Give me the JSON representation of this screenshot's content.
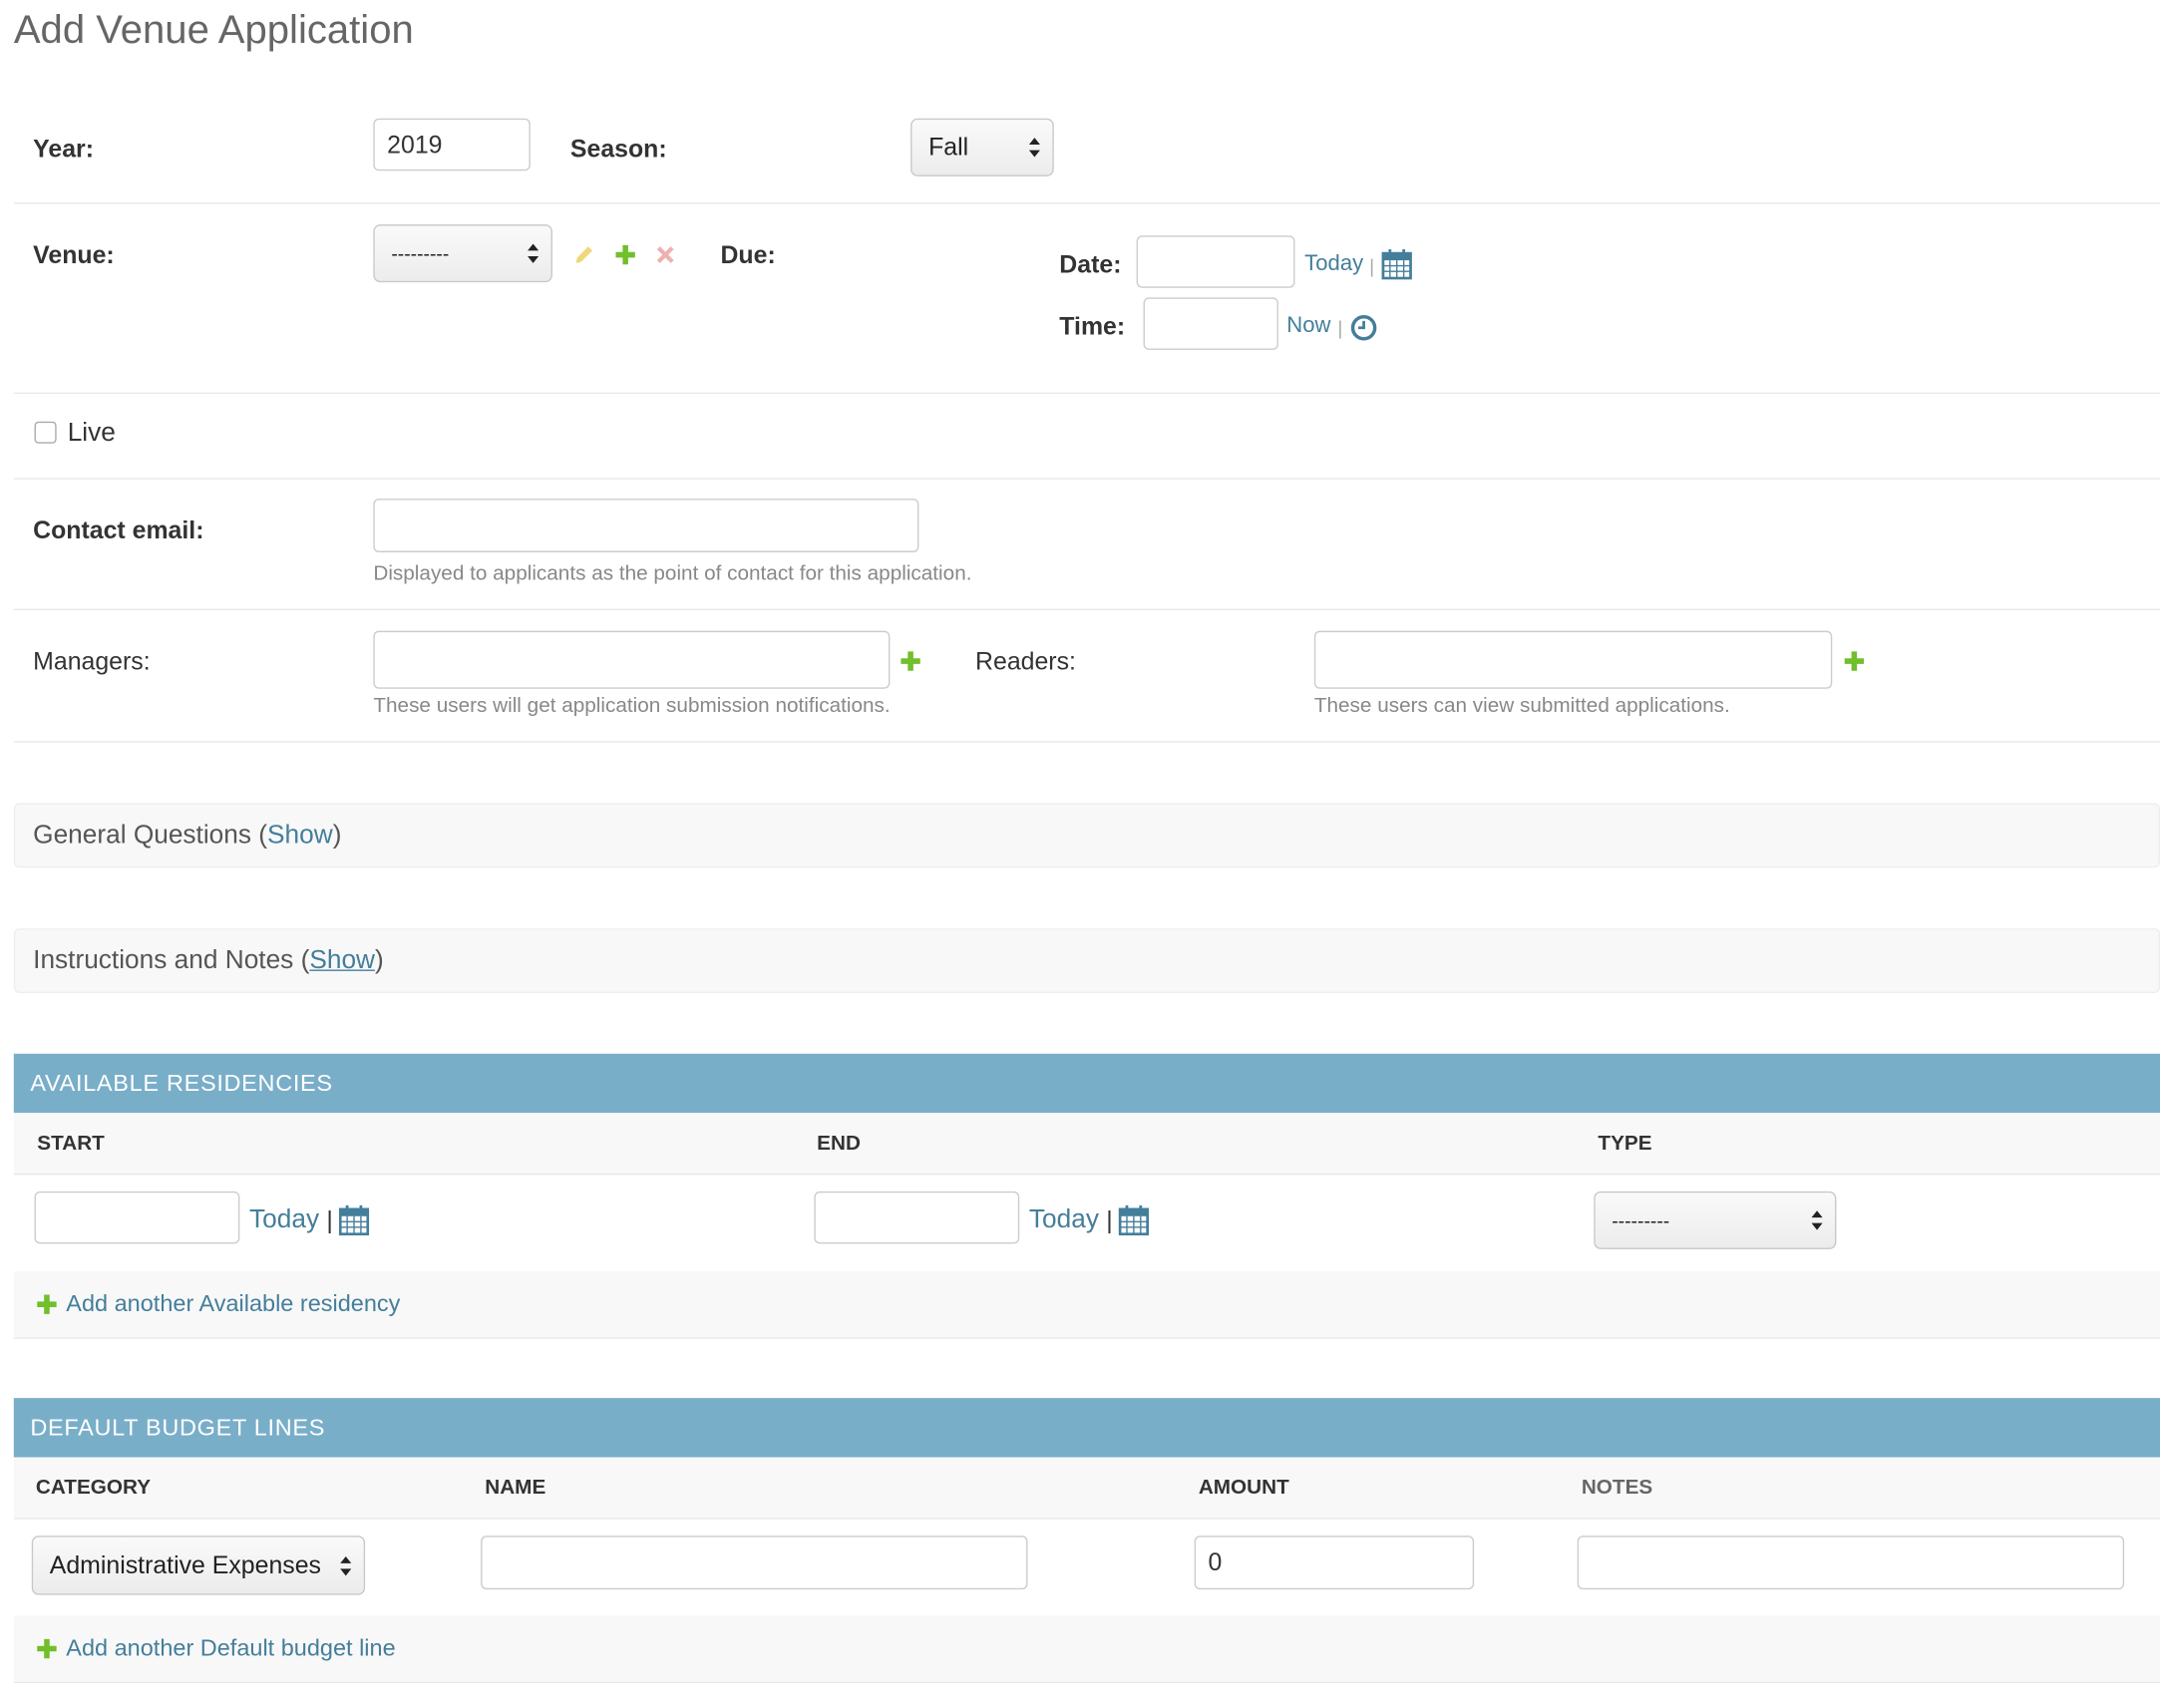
{
  "page": {
    "title": "Add Venue Application"
  },
  "year": {
    "label": "Year:",
    "value": "2019"
  },
  "season": {
    "label": "Season:",
    "value": "Fall"
  },
  "venue": {
    "label": "Venue:",
    "value": "---------"
  },
  "due": {
    "label": "Due:",
    "date_label": "Date:",
    "date_value": "",
    "today_link": "Today",
    "sep": "|",
    "time_label": "Time:",
    "time_value": "",
    "now_link": "Now"
  },
  "live": {
    "label": "Live",
    "checked": false
  },
  "contact_email": {
    "label": "Contact email:",
    "value": "",
    "help": "Displayed to applicants as the point of contact for this application."
  },
  "managers": {
    "label": "Managers:",
    "help": "These users will get application submission notifications."
  },
  "readers": {
    "label": "Readers:",
    "help": "These users can view submitted applications."
  },
  "fieldsets": {
    "general": {
      "title": "General Questions",
      "open_paren": "(",
      "show": "Show",
      "close_paren": ")"
    },
    "instructions": {
      "title": "Instructions and Notes",
      "open_paren": "(",
      "show": "Show",
      "close_paren": ")"
    }
  },
  "residencies": {
    "title": "AVAILABLE RESIDENCIES",
    "columns": {
      "start": "START",
      "end": "END",
      "type": "TYPE"
    },
    "row": {
      "start": "",
      "end": "",
      "type": "---------",
      "today": "Today",
      "sep": "|"
    },
    "add": "Add another Available residency"
  },
  "budget": {
    "title": "DEFAULT BUDGET LINES",
    "columns": {
      "category": "CATEGORY",
      "name": "NAME",
      "amount": "AMOUNT",
      "notes": "NOTES"
    },
    "row": {
      "category": "Administrative Expenses",
      "name": "",
      "amount": "0",
      "notes": ""
    },
    "add": "Add another Default budget line"
  },
  "colors": {
    "accent": "#79aec8",
    "link": "#447e9b",
    "add": "#70bf2b",
    "delete": "#efb0b0",
    "change": "#efd77a"
  }
}
